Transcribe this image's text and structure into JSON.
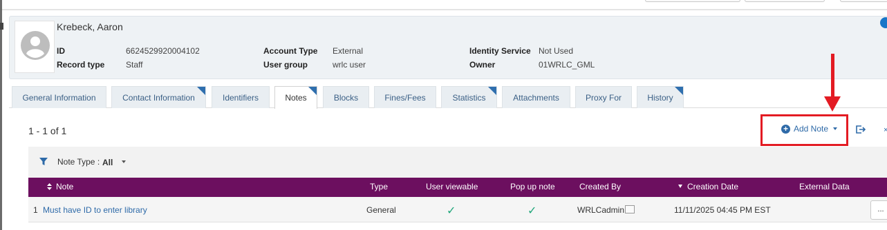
{
  "user": {
    "name": "Krebeck, Aaron",
    "fields": [
      {
        "label": "ID",
        "value": "6624529920004102"
      },
      {
        "label": "Record type",
        "value": "Staff"
      },
      {
        "label": "Account Type",
        "value": "External"
      },
      {
        "label": "User group",
        "value": "wrlc user"
      },
      {
        "label": "Identity Service",
        "value": "Not Used"
      },
      {
        "label": "Owner",
        "value": "01WRLC_GML"
      }
    ]
  },
  "tabs": [
    {
      "label": "General Information",
      "active": false,
      "indicator": false
    },
    {
      "label": "Contact Information",
      "active": false,
      "indicator": true
    },
    {
      "label": "Identifiers",
      "active": false,
      "indicator": false
    },
    {
      "label": "Notes",
      "active": true,
      "indicator": true
    },
    {
      "label": "Blocks",
      "active": false,
      "indicator": false
    },
    {
      "label": "Fines/Fees",
      "active": false,
      "indicator": false
    },
    {
      "label": "Statistics",
      "active": false,
      "indicator": true
    },
    {
      "label": "Attachments",
      "active": false,
      "indicator": false
    },
    {
      "label": "Proxy For",
      "active": false,
      "indicator": false
    },
    {
      "label": "History",
      "active": false,
      "indicator": true
    }
  ],
  "notes": {
    "range": "1 - 1 of 1",
    "add_label": "Add Note",
    "filter": {
      "label": "Note Type :",
      "value": "All"
    },
    "columns": [
      "Note",
      "Type",
      "User viewable",
      "Pop up note",
      "Created By",
      "Creation Date",
      "External Data"
    ],
    "rows": [
      {
        "index": "1",
        "note": "Must have ID to enter library",
        "type": "General",
        "user_viewable": "✓",
        "popup": "✓",
        "created_by": "WRLCadmin",
        "created_date": "11/11/2025 04:45 PM EST",
        "action": "..."
      }
    ]
  },
  "colors": {
    "accent": "#2e6aa8",
    "table_header": "#6c0f5f",
    "annotation": "#e31b23",
    "check": "#1fa67a"
  }
}
